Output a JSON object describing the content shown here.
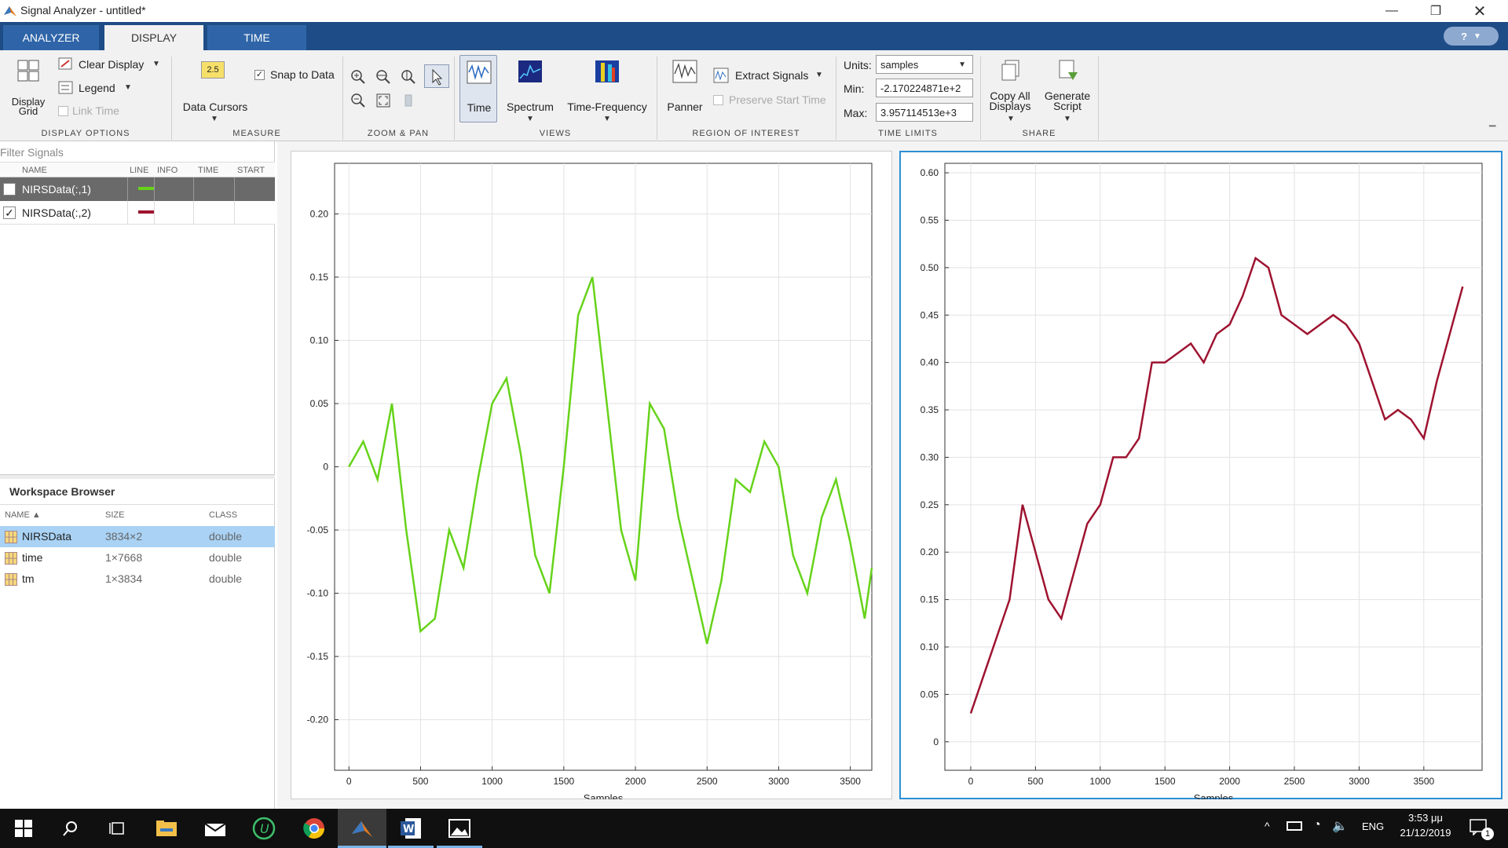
{
  "window": {
    "title": "Signal Analyzer - untitled*"
  },
  "tabs": [
    {
      "label": "ANALYZER",
      "active": false
    },
    {
      "label": "DISPLAY",
      "active": true
    },
    {
      "label": "TIME",
      "active": false
    }
  ],
  "ribbon": {
    "display_options": {
      "display_grid": "Display Grid",
      "clear_display": "Clear Display",
      "legend": "Legend",
      "link_time": "Link Time",
      "label": "DISPLAY OPTIONS"
    },
    "measure": {
      "data_cursors": "Data Cursors",
      "snap_to_data": "Snap to Data",
      "cursor_icon_text": "2.5",
      "label": "MEASURE"
    },
    "zoom_pan": {
      "label": "ZOOM & PAN"
    },
    "views": {
      "time": "Time",
      "spectrum": "Spectrum",
      "time_frequency": "Time-Frequency",
      "label": "VIEWS"
    },
    "roi": {
      "panner": "Panner",
      "extract_signals": "Extract Signals",
      "preserve_start_time": "Preserve Start Time",
      "label": "REGION OF INTEREST"
    },
    "time_limits": {
      "units_label": "Units:",
      "units_value": "samples",
      "min_label": "Min:",
      "min_value": "-2.170224871e+2",
      "max_label": "Max:",
      "max_value": "3.957114513e+3",
      "label": "TIME LIMITS"
    },
    "share": {
      "copy_all_displays": "Copy All Displays",
      "generate_script": "Generate Script",
      "label": "SHARE"
    }
  },
  "signals_panel": {
    "filter_placeholder": "Filter Signals",
    "columns": [
      "NAME",
      "LINE",
      "INFO",
      "TIME",
      "START"
    ],
    "rows": [
      {
        "name": "NIRSData(:,1)",
        "color": "#66d31a",
        "selected": true,
        "checked": false
      },
      {
        "name": "NIRSData(:,2)",
        "color": "#9e1330",
        "selected": false,
        "checked": true
      }
    ]
  },
  "workspace": {
    "title": "Workspace Browser",
    "columns": [
      "NAME ▲",
      "SIZE",
      "CLASS"
    ],
    "rows": [
      {
        "name": "NIRSData",
        "size": "3834×2",
        "class": "double",
        "selected": true
      },
      {
        "name": "time",
        "size": "1×7668",
        "class": "double",
        "selected": false
      },
      {
        "name": "tm",
        "size": "1×3834",
        "class": "double",
        "selected": false
      }
    ]
  },
  "chart_data": [
    {
      "type": "line",
      "series": [
        {
          "color": "#66d31a"
        }
      ],
      "xlabel": "Samples",
      "xlim": [
        -100,
        3650
      ],
      "ylim": [
        -0.24,
        0.24
      ],
      "xticks": [
        "0",
        "500",
        "1000",
        "1500",
        "2000",
        "2500",
        "3000",
        "3500"
      ],
      "yticks": [
        "0.20",
        "0.15",
        "0.10",
        "0.05",
        "0",
        "-0.05",
        "-0.10",
        "-0.15",
        "-0.20"
      ],
      "x": [
        0,
        100,
        200,
        300,
        400,
        500,
        600,
        700,
        800,
        900,
        1000,
        1100,
        1200,
        1300,
        1400,
        1500,
        1600,
        1700,
        1800,
        1900,
        2000,
        2100,
        2200,
        2300,
        2400,
        2500,
        2600,
        2700,
        2800,
        2900,
        3000,
        3100,
        3200,
        3300,
        3400,
        3500,
        3600,
        3650
      ],
      "y": [
        0.0,
        0.02,
        -0.01,
        0.05,
        -0.05,
        -0.13,
        -0.12,
        -0.05,
        -0.08,
        -0.01,
        0.05,
        0.07,
        0.01,
        -0.07,
        -0.1,
        0.0,
        0.12,
        0.15,
        0.05,
        -0.05,
        -0.09,
        0.05,
        0.03,
        -0.04,
        -0.09,
        -0.14,
        -0.09,
        -0.01,
        -0.02,
        0.02,
        0.0,
        -0.07,
        -0.1,
        -0.04,
        -0.01,
        -0.06,
        -0.12,
        -0.08
      ],
      "grid": true
    },
    {
      "type": "line",
      "series": [
        {
          "color": "#9e1330"
        }
      ],
      "xlabel": "Samples",
      "xlim": [
        -200,
        3950
      ],
      "ylim": [
        -0.03,
        0.61
      ],
      "xticks": [
        "0",
        "500",
        "1000",
        "1500",
        "2000",
        "2500",
        "3000",
        "3500"
      ],
      "yticks": [
        "0.60",
        "0.55",
        "0.50",
        "0.45",
        "0.40",
        "0.35",
        "0.30",
        "0.25",
        "0.20",
        "0.15",
        "0.10",
        "0.05",
        "0"
      ],
      "x": [
        0,
        100,
        200,
        300,
        400,
        500,
        600,
        700,
        800,
        900,
        1000,
        1100,
        1200,
        1300,
        1400,
        1500,
        1600,
        1700,
        1800,
        1900,
        2000,
        2100,
        2200,
        2300,
        2400,
        2500,
        2600,
        2700,
        2800,
        2900,
        3000,
        3100,
        3200,
        3300,
        3400,
        3500,
        3600,
        3700,
        3800
      ],
      "y": [
        0.03,
        0.07,
        0.11,
        0.15,
        0.25,
        0.2,
        0.15,
        0.13,
        0.18,
        0.23,
        0.25,
        0.3,
        0.3,
        0.32,
        0.4,
        0.4,
        0.41,
        0.42,
        0.4,
        0.43,
        0.44,
        0.47,
        0.51,
        0.5,
        0.45,
        0.44,
        0.43,
        0.44,
        0.45,
        0.44,
        0.42,
        0.38,
        0.34,
        0.35,
        0.34,
        0.32,
        0.38,
        0.43,
        0.48
      ],
      "grid": true
    }
  ],
  "taskbar": {
    "lang": "ENG",
    "time": "3:53 μμ",
    "date": "21/12/2019",
    "notif_count": "1"
  }
}
